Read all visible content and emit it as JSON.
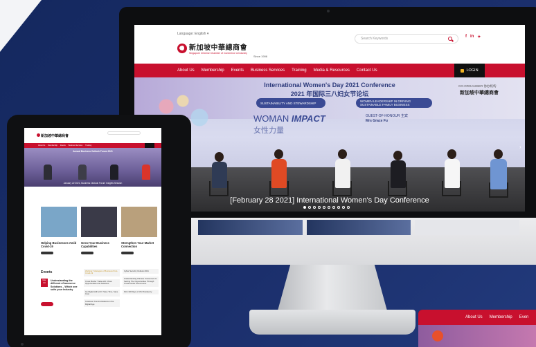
{
  "monitor": {
    "language_label": "Language:",
    "language_value": "English",
    "logo_cn": "新加坡中華總商會",
    "logo_en": "Singapore Chinese Chamber of Commerce & Industry",
    "since": "Since 1906",
    "search_placeholder": "Search Keywords",
    "socials": [
      "f",
      "in",
      "✦"
    ],
    "nav_items": [
      "About Us",
      "Membership",
      "Events",
      "Business Services",
      "Training",
      "Media & Resources",
      "Contact Us"
    ],
    "login_label": "LOGIN",
    "hero": {
      "title_en": "International Women's Day 2021 Conference",
      "title_cn": "2021 年国际三八妇女节论坛",
      "badge_left": "SUSTAINABILITY AND STEWARDSHIP",
      "badge_right": "WOMEN LEADERSHIP IN DRIVING SUSTAINABLE FAMILY BUSINESS",
      "woman": "WOMAN",
      "impact": "IMPACT",
      "cn_sub": "女性力量",
      "guest_label": "GUEST-OF-HONOUR 主宾",
      "guest_name": "Mrs Grace Fu",
      "organiser": "CO-ORGANISER 协办机构",
      "caption": "[February 28 2021] International Women's Day Conference",
      "slide_count": 10,
      "active_slide": 0
    }
  },
  "partial_screen": {
    "nav_items": [
      "About Us",
      "Membership",
      "Even"
    ]
  },
  "tablet": {
    "hero_title": "Annual Business Outlook Forum 2021",
    "hero_caption": "January 22 2021, Business Outlook Forum Insights Session",
    "cards": [
      {
        "title": "Helping Businesses Amid Covid-19",
        "color": "#7aa6c8"
      },
      {
        "title": "Grow Your Business Capabilities",
        "color": "#3a3a48"
      },
      {
        "title": "Strengthen Your Market Connection",
        "color": "#b9a07c"
      }
    ],
    "events_label": "Events",
    "event_date_month": "Mar",
    "event_date_day": "03",
    "event_title": "Understanding the different eCommerce Solutions – Which one suits your Industry",
    "col1": [
      "Cross Border Trade with China: Opportunities and Solutions",
      "Go Digital with eCO: Save Time, Save Cost",
      "Customer Communications in the Digital Age"
    ],
    "col1_highlight": "Webinar: Strategies of Business Post-Covid-19",
    "col2": [
      "Cyber Security Outlook 2021",
      "Understanding Chinese Consumers & Seizing The Opportunities Through Cross-border eCommerce",
      "First 100 Days of US Presidency"
    ]
  },
  "colors": {
    "brand_red": "#c8102e",
    "navy": "#1b2f6c",
    "login_black": "#111111"
  }
}
